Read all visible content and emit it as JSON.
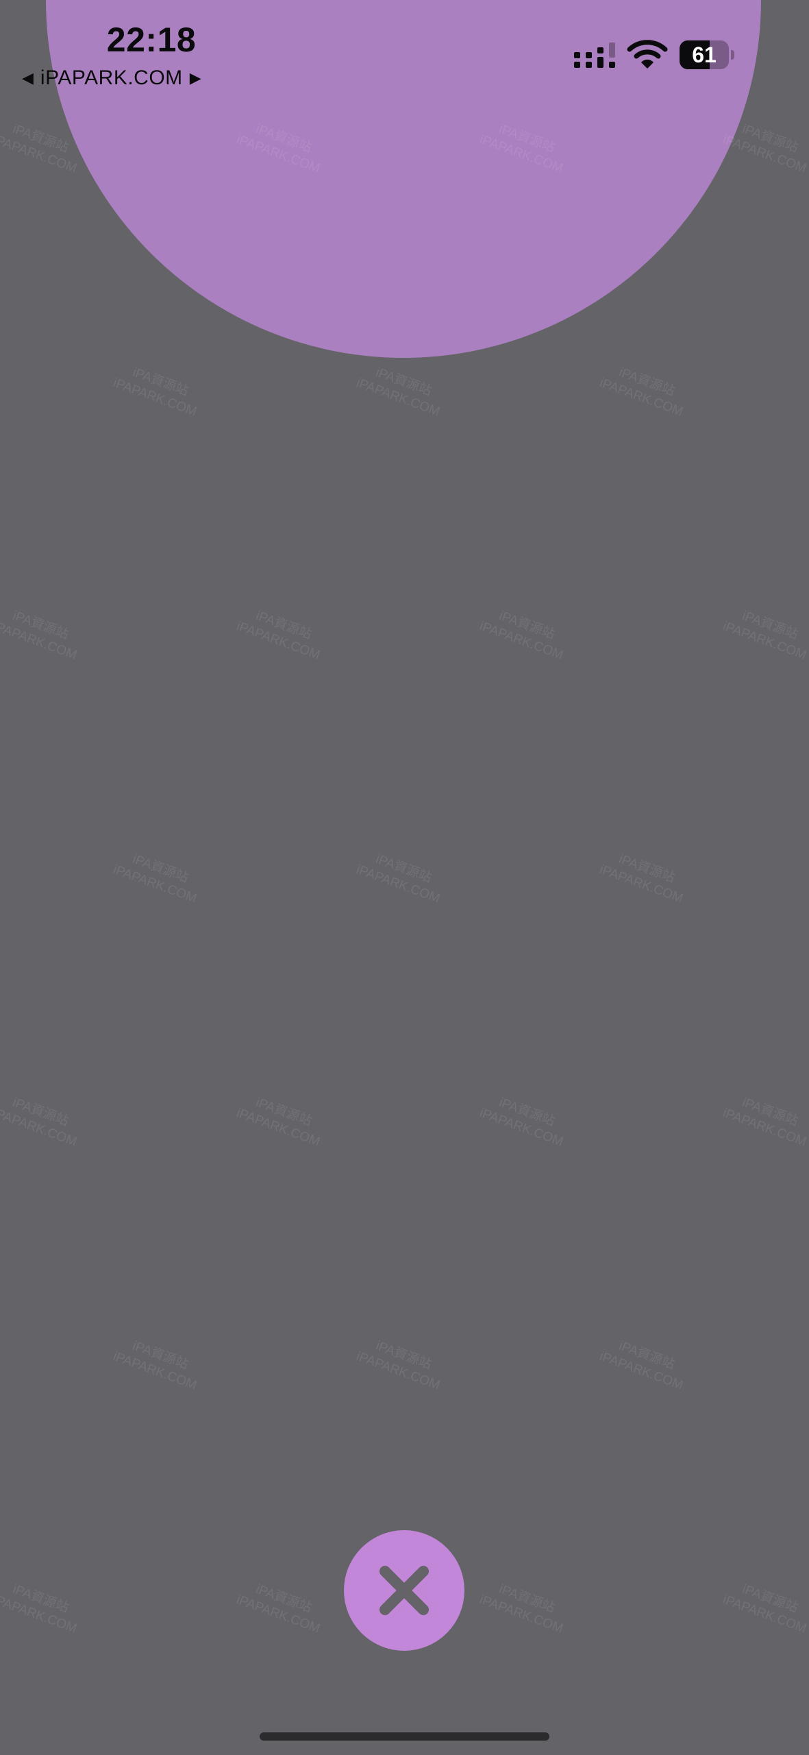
{
  "status_bar": {
    "time": "22:18",
    "back_arrow": "◀",
    "back_label": "iPAPARK.COM",
    "forward_arrow": "▶",
    "signal_icon": "cellular-signal-icon",
    "wifi_icon": "wifi-icon",
    "battery_level": "61"
  },
  "watermark": {
    "line1": "iPA資源站",
    "line2": "iPAPARK.COM"
  },
  "close_button": {
    "icon": "close-icon"
  },
  "colors": {
    "background": "#646368",
    "hero_circle": "#ab80c0",
    "close_button": "#c287d8",
    "close_icon": "#646368",
    "status_text": "#0b0b0d"
  }
}
